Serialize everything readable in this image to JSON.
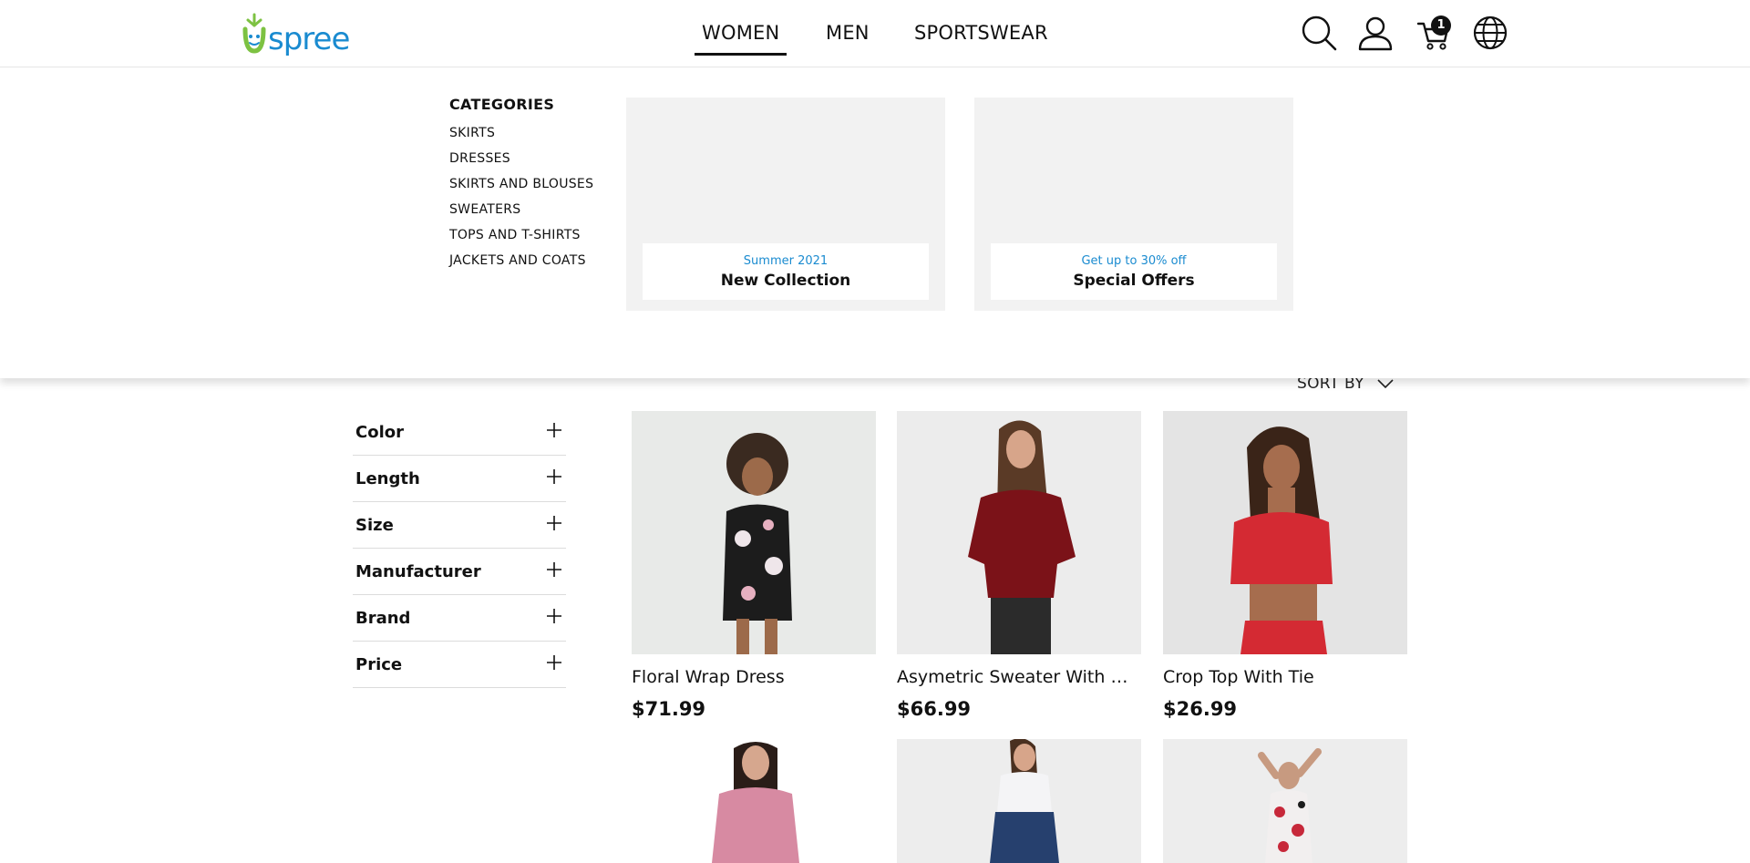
{
  "header": {
    "logo_text": "spree",
    "nav": [
      "WOMEN",
      "MEN",
      "SPORTSWEAR"
    ],
    "active_nav": "WOMEN",
    "cart_count": "1",
    "icons": [
      "search-icon",
      "account-icon",
      "cart-icon",
      "globe-icon"
    ]
  },
  "mega_menu": {
    "categories_heading": "CATEGORIES",
    "categories": [
      "SKIRTS",
      "DRESSES",
      "SKIRTS AND BLOUSES",
      "SWEATERS",
      "TOPS AND T-SHIRTS",
      "JACKETS AND COATS"
    ],
    "promos": [
      {
        "subtitle": "Summer 2021",
        "title": "New Collection"
      },
      {
        "subtitle": "Get up to 30% off",
        "title": "Special Offers"
      }
    ]
  },
  "sort": {
    "label": "SORT BY"
  },
  "filters": [
    "Color",
    "Length",
    "Size",
    "Manufacturer",
    "Brand",
    "Price"
  ],
  "products": [
    {
      "name": "Floral Wrap Dress",
      "price": "$71.99"
    },
    {
      "name": "Asymetric Sweater With Wide Sleeves",
      "price": "$66.99"
    },
    {
      "name": "Crop Top With Tie",
      "price": "$26.99"
    }
  ],
  "colors": {
    "brand_blue": "#1a8bd0",
    "brand_green": "#7dc242",
    "text": "#111111"
  }
}
